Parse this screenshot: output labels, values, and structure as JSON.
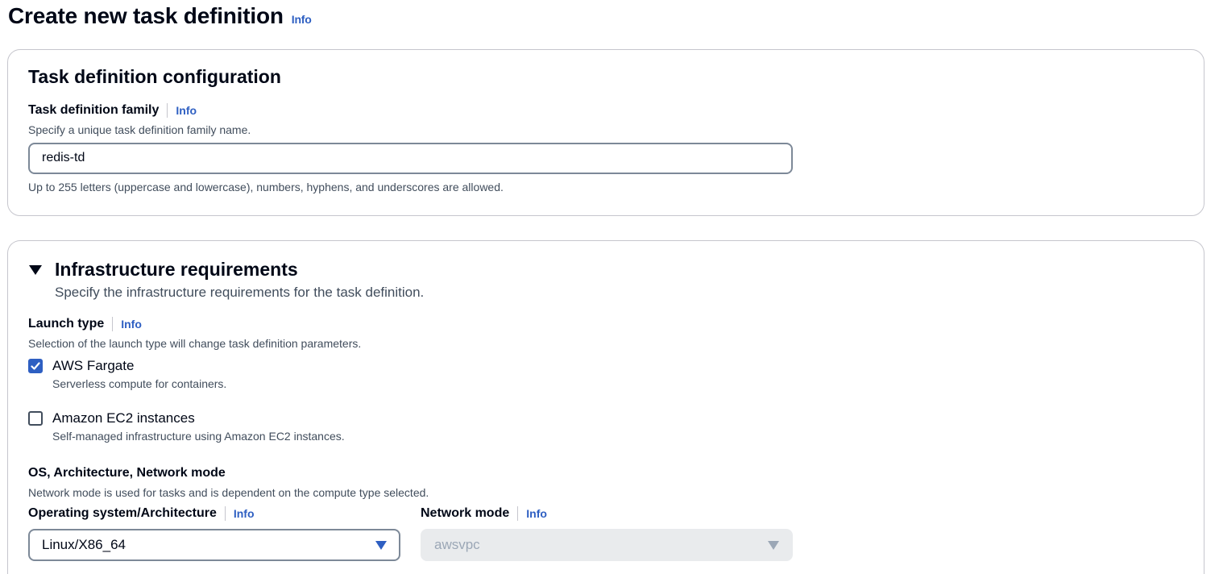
{
  "page": {
    "title": "Create new task definition",
    "info": "Info"
  },
  "config_panel": {
    "heading": "Task definition configuration",
    "family": {
      "label": "Task definition family",
      "info": "Info",
      "description": "Specify a unique task definition family name.",
      "value": "redis-td",
      "constraint": "Up to 255 letters (uppercase and lowercase), numbers, hyphens, and underscores are allowed."
    }
  },
  "infra_panel": {
    "heading": "Infrastructure requirements",
    "expanded": true,
    "description": "Specify the infrastructure requirements for the task definition.",
    "launch_type": {
      "label": "Launch type",
      "info": "Info",
      "description": "Selection of the launch type will change task definition parameters.",
      "options": [
        {
          "label": "AWS Fargate",
          "description": "Serverless compute for containers.",
          "checked": true
        },
        {
          "label": "Amazon EC2 instances",
          "description": "Self-managed infrastructure using Amazon EC2 instances.",
          "checked": false
        }
      ]
    },
    "os_section": {
      "label": "OS, Architecture, Network mode",
      "description": "Network mode is used for tasks and is dependent on the compute type selected."
    },
    "os_arch": {
      "label": "Operating system/Architecture",
      "info": "Info",
      "value": "Linux/X86_64"
    },
    "network_mode": {
      "label": "Network mode",
      "info": "Info",
      "value": "awsvpc",
      "disabled": true
    }
  },
  "colors": {
    "accent": "#2e5fc2",
    "border": "#c6c6cd",
    "text": "#000716",
    "muted_text": "#414d5c",
    "disabled_bg": "#e9ebed"
  },
  "icons": [
    "caret-down-icon",
    "checkmark-icon",
    "dropdown-arrow-icon"
  ]
}
